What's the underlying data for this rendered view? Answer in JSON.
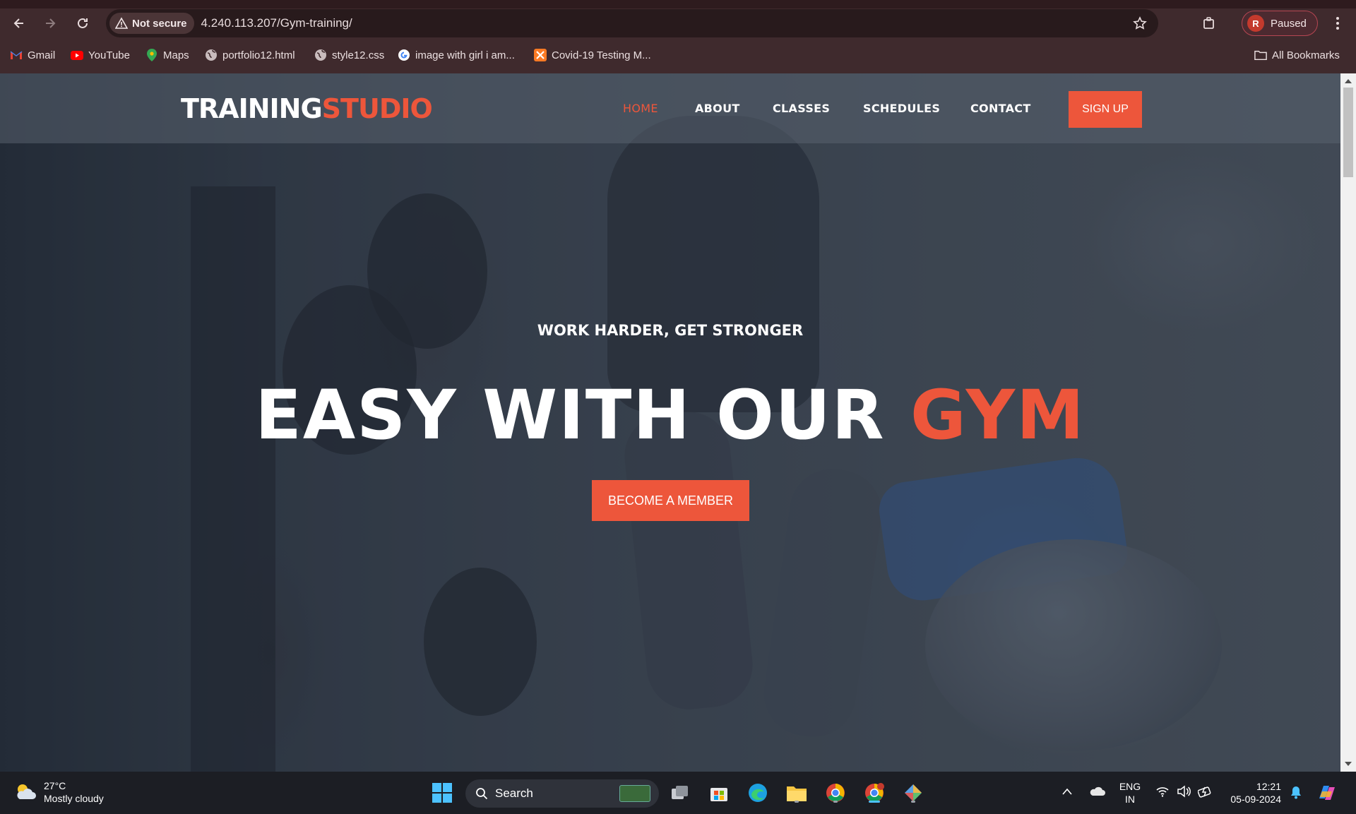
{
  "browser": {
    "security_label": "Not secure",
    "url": "4.240.113.207/Gym-training/",
    "profile_initial": "R",
    "profile_status": "Paused",
    "bookmarks": [
      {
        "label": "Gmail",
        "icon": "gmail-icon"
      },
      {
        "label": "YouTube",
        "icon": "youtube-icon"
      },
      {
        "label": "Maps",
        "icon": "maps-icon"
      },
      {
        "label": "portfolio12.html",
        "icon": "globe-icon"
      },
      {
        "label": "style12.css",
        "icon": "globe-icon"
      },
      {
        "label": "image with girl i am...",
        "icon": "google-icon"
      },
      {
        "label": "Covid-19 Testing M...",
        "icon": "xampp-icon"
      }
    ],
    "all_bookmarks_label": "All Bookmarks"
  },
  "site": {
    "logo_white": "TRAINING",
    "logo_orange": "STUDIO",
    "nav": [
      {
        "label": "HOME",
        "active": true
      },
      {
        "label": "ABOUT",
        "active": false
      },
      {
        "label": "CLASSES",
        "active": false
      },
      {
        "label": "SCHEDULES",
        "active": false
      },
      {
        "label": "CONTACT",
        "active": false
      }
    ],
    "signup_label": "SIGN UP",
    "tagline": "WORK HARDER, GET STRONGER",
    "headline_white": "EASY WITH OUR",
    "headline_orange": "GYM",
    "cta_label": "BECOME A MEMBER",
    "accent_color": "#ed563b"
  },
  "taskbar": {
    "temperature": "27°C",
    "weather": "Mostly cloudy",
    "search_label": "Search",
    "language_line1": "ENG",
    "language_line2": "IN",
    "time": "12:21",
    "date": "05-09-2024"
  }
}
